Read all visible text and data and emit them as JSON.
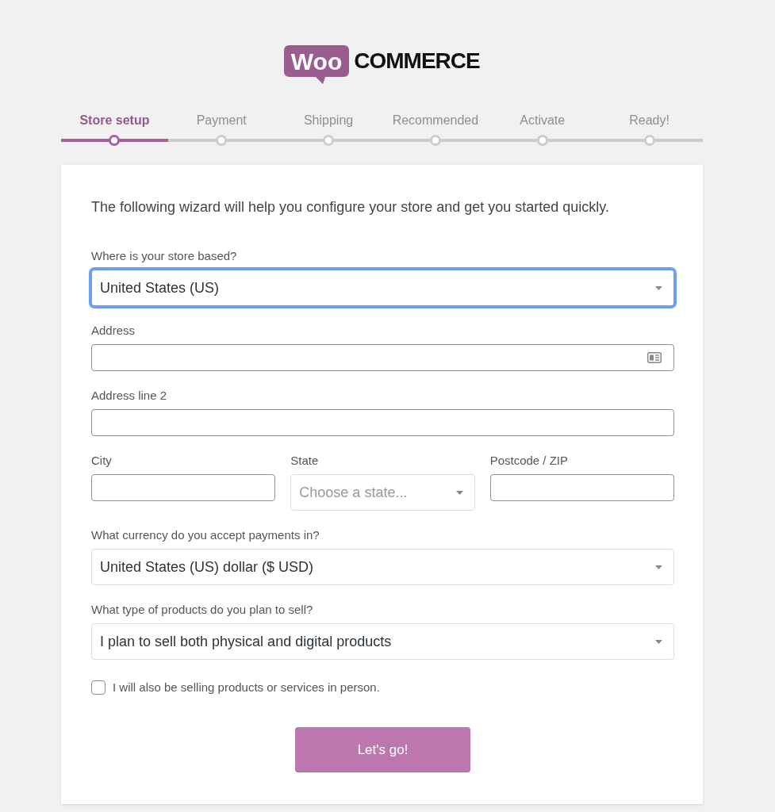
{
  "logo": {
    "badge": "Woo",
    "wordmark": "COMMERCE"
  },
  "steps": [
    {
      "label": "Store setup",
      "selected": true
    },
    {
      "label": "Payment",
      "selected": false
    },
    {
      "label": "Shipping",
      "selected": false
    },
    {
      "label": "Recommended",
      "selected": false
    },
    {
      "label": "Activate",
      "selected": false
    },
    {
      "label": "Ready!",
      "selected": false
    }
  ],
  "intro": "The following wizard will help you configure your store and get you started quickly.",
  "rows": [
    {
      "fields": [
        {
          "kind": "select",
          "label": "Where is your store based?",
          "value": "United States (US)",
          "focused": true
        }
      ]
    },
    {
      "fields": [
        {
          "kind": "text",
          "label": "Address",
          "autofill_icon": true,
          "focused": false
        }
      ]
    },
    {
      "fields": [
        {
          "kind": "text",
          "label": "Address line 2",
          "autofill_icon": false,
          "focused": false
        }
      ]
    },
    {
      "fields": [
        {
          "kind": "text",
          "label": "City",
          "autofill_icon": false,
          "focused": false
        },
        {
          "kind": "select",
          "label": "State",
          "placeholder": "Choose a state...",
          "focused": false
        },
        {
          "kind": "text",
          "label": "Postcode / ZIP",
          "autofill_icon": false,
          "focused": false
        }
      ]
    },
    {
      "fields": [
        {
          "kind": "select",
          "label": "What currency do you accept payments in?",
          "value": "United States (US) dollar ($ USD)",
          "focused": false
        }
      ]
    },
    {
      "fields": [
        {
          "kind": "select",
          "label": "What type of products do you plan to sell?",
          "value": "I plan to sell both physical and digital products",
          "focused": false
        }
      ]
    }
  ],
  "checkbox": {
    "label": "I will also be selling products or services in person.",
    "checked": false
  },
  "button": {
    "label": "Let's go!"
  }
}
